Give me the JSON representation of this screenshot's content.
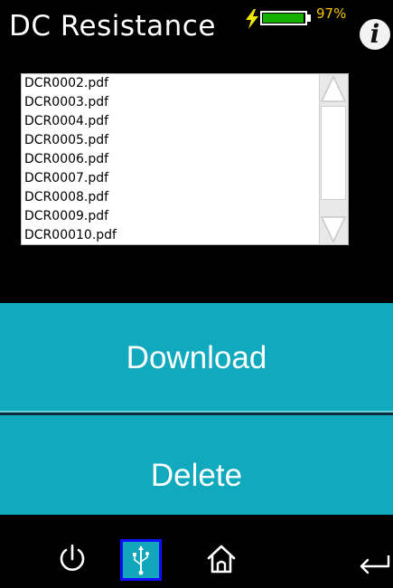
{
  "header": {
    "title": "DC Resistance",
    "battery_percent_label": "97%",
    "battery_level": 0.97,
    "info_icon": "i"
  },
  "file_list": {
    "items": [
      "DCR0002.pdf",
      "DCR0003.pdf",
      "DCR0004.pdf",
      "DCR0005.pdf",
      "DCR0006.pdf",
      "DCR0007.pdf",
      "DCR0008.pdf",
      "DCR0009.pdf",
      "DCR00010.pdf"
    ]
  },
  "actions": {
    "download_label": "Download",
    "delete_label": "Delete"
  },
  "nav": {
    "items": [
      "power-icon",
      "usb-icon",
      "home-icon",
      "back-arrow-icon"
    ],
    "active": "usb-icon"
  },
  "colors": {
    "background": "#000000",
    "button_teal": "#11a9be",
    "battery_green": "#14b000",
    "battery_text": "#f5c400",
    "active_outline": "#1010ff"
  }
}
